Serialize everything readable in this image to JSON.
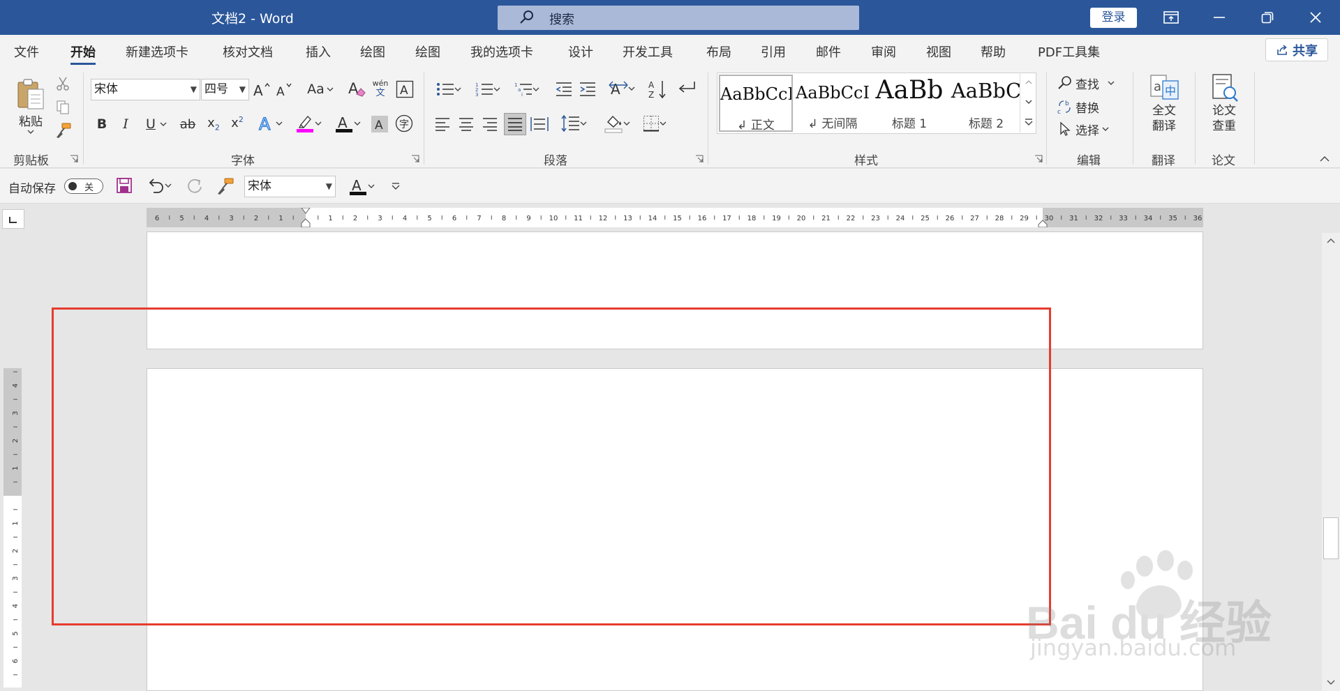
{
  "titlebar": {
    "doc_title": "文档2  -  Word",
    "search_label": "搜索",
    "login_label": "登录"
  },
  "tabs": [
    "文件",
    "开始",
    "新建选项卡",
    "核对文档",
    "插入",
    "绘图",
    "绘图",
    "我的选项卡",
    "设计",
    "开发工具",
    "布局",
    "引用",
    "邮件",
    "审阅",
    "视图",
    "帮助",
    "PDF工具集"
  ],
  "share_label": "共享",
  "ribbon": {
    "clipboard": {
      "paste_label": "粘贴",
      "group_label": "剪贴板"
    },
    "font": {
      "font_name": "宋体",
      "font_size": "四号",
      "case_label": "Aa",
      "phonetic_top": "wén",
      "phonetic_bottom": "文",
      "enclose_label": "字",
      "group_label": "字体"
    },
    "paragraph": {
      "group_label": "段落"
    },
    "styles": {
      "group_label": "样式",
      "items": [
        {
          "preview": "AaBbCcI",
          "name": "↲ 正文"
        },
        {
          "preview": "AaBbCcI",
          "name": "↲ 无间隔"
        },
        {
          "preview": "AaBb",
          "name": "标题 1"
        },
        {
          "preview": "AaBbC",
          "name": "标题 2"
        }
      ]
    },
    "editing": {
      "find_label": "查找",
      "replace_label": "替换",
      "select_label": "选择",
      "group_label": "编辑"
    },
    "translate": {
      "button_label_1": "全文",
      "button_label_2": "翻译",
      "group_label": "翻译"
    },
    "paper": {
      "button_label_1": "论文",
      "button_label_2": "查重",
      "group_label": "论文"
    }
  },
  "qat": {
    "autosave_label": "自动保存",
    "autosave_state": "关",
    "font_name": "宋体"
  },
  "ruler": {
    "left_numbers": [
      "6",
      "5",
      "4",
      "3",
      "2",
      "1"
    ],
    "right_numbers": [
      "1",
      "2",
      "3",
      "4",
      "5",
      "6",
      "7",
      "8",
      "9",
      "10",
      "11",
      "12",
      "13",
      "14",
      "15",
      "16",
      "17",
      "18",
      "19",
      "20",
      "21",
      "22",
      "23",
      "24",
      "25",
      "26",
      "27",
      "28",
      "29",
      "30",
      "31",
      "32",
      "33",
      "34",
      "35",
      "36"
    ],
    "vertical_top_numbers": [
      "4",
      "3",
      "2",
      "1"
    ],
    "vertical_bottom_numbers": [
      "1",
      "2",
      "3",
      "4",
      "5",
      "6"
    ]
  },
  "watermark": {
    "brand": "Bai du 经验",
    "url": "jingyan.baidu.com"
  },
  "colors": {
    "word_blue": "#2b579a",
    "highlight_color": "#ff00ff",
    "annotation_red": "#e63b2e"
  }
}
